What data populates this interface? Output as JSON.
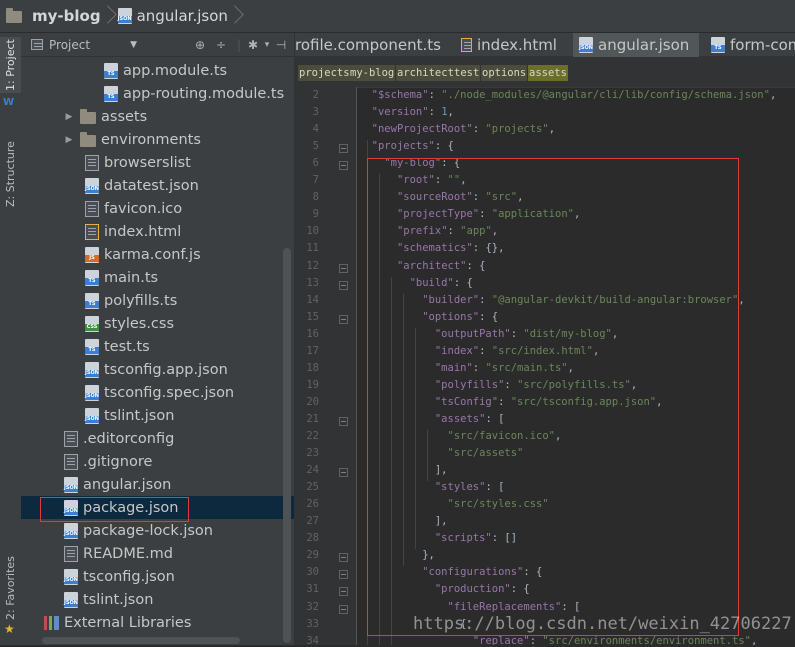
{
  "title_bar": {
    "project": "my-blog",
    "file": "angular.json"
  },
  "tool_stripe": {
    "project_tab": "1: Project",
    "structure_tab": "Z: Structure",
    "favorites_tab": "2: Favorites"
  },
  "project_panel": {
    "view_mode": "Project",
    "tree": [
      {
        "label": "app.module.ts",
        "icon": "ts-file-icon"
      },
      {
        "label": "app-routing.module.ts",
        "icon": "ts-file-icon"
      },
      {
        "label": "assets",
        "icon": "folder-icon"
      },
      {
        "label": "environments",
        "icon": "folder-icon"
      },
      {
        "label": "browserslist",
        "icon": "text-file-icon"
      },
      {
        "label": "datatest.json",
        "icon": "json-file-icon"
      },
      {
        "label": "favicon.ico",
        "icon": "image-file-icon"
      },
      {
        "label": "index.html",
        "icon": "html-file-icon"
      },
      {
        "label": "karma.conf.js",
        "icon": "js-file-icon"
      },
      {
        "label": "main.ts",
        "icon": "ts-file-icon"
      },
      {
        "label": "polyfills.ts",
        "icon": "ts-file-icon"
      },
      {
        "label": "styles.css",
        "icon": "css-file-icon"
      },
      {
        "label": "test.ts",
        "icon": "ts-file-icon"
      },
      {
        "label": "tsconfig.app.json",
        "icon": "json-file-icon"
      },
      {
        "label": "tsconfig.spec.json",
        "icon": "json-file-icon"
      },
      {
        "label": "tslint.json",
        "icon": "json-file-icon"
      },
      {
        "label": ".editorconfig",
        "icon": "text-file-icon"
      },
      {
        "label": ".gitignore",
        "icon": "text-file-icon"
      },
      {
        "label": "angular.json",
        "icon": "json-file-icon"
      },
      {
        "label": "package.json",
        "icon": "json-file-icon"
      },
      {
        "label": "package-lock.json",
        "icon": "json-file-icon"
      },
      {
        "label": "README.md",
        "icon": "text-file-icon"
      },
      {
        "label": "tsconfig.json",
        "icon": "json-file-icon"
      },
      {
        "label": "tslint.json",
        "icon": "json-file-icon"
      },
      {
        "label": "External Libraries",
        "icon": "library-icon"
      }
    ]
  },
  "editor": {
    "tabs": [
      {
        "label": "rofile.component.ts",
        "icon": "ts-file-icon"
      },
      {
        "label": "index.html",
        "icon": "html-file-icon"
      },
      {
        "label": "angular.json",
        "icon": "json-file-icon"
      },
      {
        "label": "form-com",
        "icon": "ts-file-icon"
      }
    ],
    "breadcrumbs": [
      "projects",
      "my-blog",
      "architect",
      "test",
      "options",
      "assets"
    ],
    "line_numbers": [
      "2",
      "3",
      "4",
      "5",
      "6",
      "7",
      "8",
      "9",
      "10",
      "11",
      "12",
      "13",
      "14",
      "15",
      "16",
      "17",
      "18",
      "19",
      "20",
      "21",
      "22",
      "23",
      "24",
      "25",
      "26",
      "27",
      "28",
      "29",
      "30",
      "31",
      "32",
      "33",
      "34"
    ],
    "code_lines": [
      "  \"$schema\": \"./node_modules/@angular/cli/lib/config/schema.json\",",
      "  \"version\": 1,",
      "  \"newProjectRoot\": \"projects\",",
      "  \"projects\": {",
      "    \"my-blog\": {",
      "      \"root\": \"\",",
      "      \"sourceRoot\": \"src\",",
      "      \"projectType\": \"application\",",
      "      \"prefix\": \"app\",",
      "      \"schematics\": {},",
      "      \"architect\": {",
      "        \"build\": {",
      "          \"builder\": \"@angular-devkit/build-angular:browser\",",
      "          \"options\": {",
      "            \"outputPath\": \"dist/my-blog\",",
      "            \"index\": \"src/index.html\",",
      "            \"main\": \"src/main.ts\",",
      "            \"polyfills\": \"src/polyfills.ts\",",
      "            \"tsConfig\": \"src/tsconfig.app.json\",",
      "            \"assets\": [",
      "              \"src/favicon.ico\",",
      "              \"src/assets\"",
      "            ],",
      "            \"styles\": [",
      "              \"src/styles.css\"",
      "            ],",
      "            \"scripts\": []",
      "          },",
      "          \"configurations\": {",
      "            \"production\": {",
      "              \"fileReplacements\": [",
      "                {",
      "                  \"replace\": \"src/environments/environment.ts\","
    ]
  },
  "watermark": "https://blog.csdn.net/weixin_42706227",
  "colors": {
    "key": "#9876aa",
    "string": "#6a8759",
    "number": "#6897bb",
    "highlight_box": "#e03a3a"
  }
}
